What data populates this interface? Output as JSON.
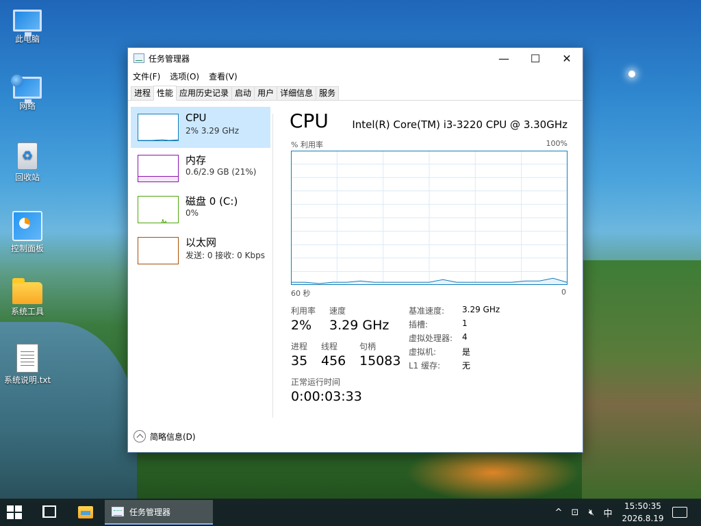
{
  "desktop": {
    "icons": [
      {
        "label": "此电脑",
        "icon": "computer-icon"
      },
      {
        "label": "网络",
        "icon": "network-icon"
      },
      {
        "label": "回收站",
        "icon": "recycle-bin-icon"
      },
      {
        "label": "控制面板",
        "icon": "control-panel-icon"
      },
      {
        "label": "系统工具",
        "icon": "folder-icon"
      },
      {
        "label": "系统说明.txt",
        "icon": "text-file-icon"
      }
    ]
  },
  "window": {
    "title": "任务管理器",
    "controls": {
      "minimize": "—",
      "maximize": "☐",
      "close": "✕"
    },
    "menu": [
      "文件(F)",
      "选项(O)",
      "查看(V)"
    ],
    "tabs": [
      "进程",
      "性能",
      "应用历史记录",
      "启动",
      "用户",
      "详细信息",
      "服务"
    ],
    "active_tab": "性能"
  },
  "sidebar": {
    "items": [
      {
        "name": "CPU",
        "detail": "2% 3.29 GHz",
        "color": "#117dbb",
        "selected": true
      },
      {
        "name": "内存",
        "detail": "0.6/2.9 GB (21%)",
        "color": "#8b12ae",
        "selected": false
      },
      {
        "name": "磁盘 0 (C:)",
        "detail": "0%",
        "color": "#4da60c",
        "selected": false
      },
      {
        "name": "以太网",
        "detail": "发送: 0 接收: 0 Kbps",
        "color": "#a74f01",
        "selected": false
      }
    ]
  },
  "cpu": {
    "title": "CPU",
    "model": "Intel(R) Core(TM) i3-3220 CPU @ 3.30GHz",
    "graph_label_left": "% 利用率",
    "graph_label_right": "100%",
    "axis_left": "60 秒",
    "axis_right": "0",
    "stats": {
      "util_label": "利用率",
      "util_value": "2%",
      "speed_label": "速度",
      "speed_value": "3.29 GHz",
      "proc_label": "进程",
      "proc_value": "35",
      "thread_label": "线程",
      "thread_value": "456",
      "handle_label": "句柄",
      "handle_value": "15083",
      "uptime_label": "正常运行时间",
      "uptime_value": "0:00:03:33"
    },
    "details": [
      {
        "k": "基准速度:",
        "v": "3.29 GHz"
      },
      {
        "k": "插槽:",
        "v": "1"
      },
      {
        "k": "虚拟处理器:",
        "v": "4"
      },
      {
        "k": "虚拟机:",
        "v": "是"
      },
      {
        "k": "L1 缓存:",
        "v": "无"
      }
    ]
  },
  "chart_data": {
    "type": "line",
    "x": [
      60,
      57,
      54,
      51,
      48,
      45,
      42,
      39,
      36,
      33,
      30,
      27,
      24,
      21,
      18,
      15,
      12,
      9,
      6,
      3,
      0
    ],
    "values": [
      1,
      1,
      0,
      1,
      1,
      2,
      1,
      1,
      1,
      1,
      1,
      3,
      1,
      1,
      1,
      1,
      1,
      2,
      2,
      4,
      1
    ],
    "ylim": [
      0,
      100
    ],
    "xlim": [
      60,
      0
    ],
    "grid": true
  },
  "footer": {
    "label": "简略信息(D)"
  },
  "taskbar": {
    "app_label": "任务管理器",
    "tray": {
      "up": "^",
      "ime": "中"
    },
    "time": "15:50:35",
    "date": "2026.8.19"
  }
}
